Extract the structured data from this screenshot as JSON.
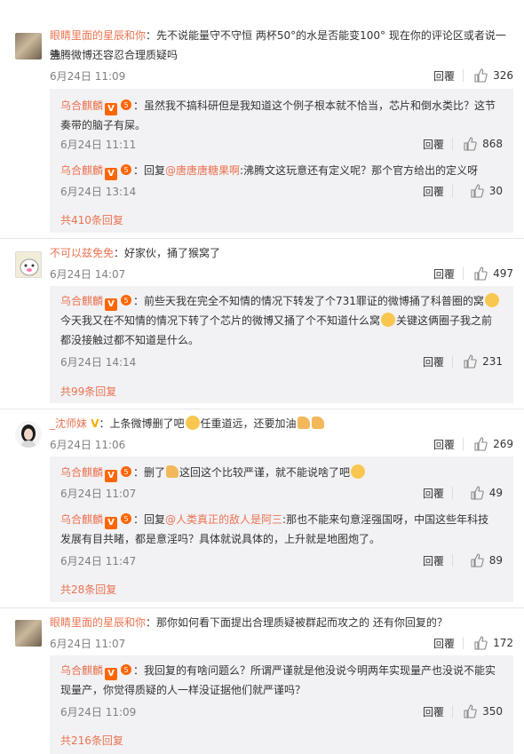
{
  "comments": [
    {
      "user": "眼睛里面的星辰和你",
      "text": "：先不说能量守不守恒 两杯50°的水是否能变100° 现在你的评论区或者说一些",
      "text2": "沸腾微博还容忍合理质疑吗",
      "time": "6月24日 11:09",
      "reply": "回覆",
      "likes": "326",
      "replies": [
        {
          "user": "乌合麒麟",
          "text": "：虽然我不搞科研但是我知道这个例子根本就不恰当，芯片和倒水类比？这节",
          "text2": "奏带的脑子有屎。",
          "time": "6月24日 11:11",
          "reply": "回覆",
          "likes": "868"
        },
        {
          "user": "乌合麒麟",
          "text_pre": "：回复",
          "mention": "@唐唐唐糖果啊",
          "text": ":沸腾文这玩意还有定义呢？那个官方给出的定义呀",
          "time": "6月24日 13:14",
          "reply": "回覆",
          "likes": "30"
        }
      ],
      "more": "共410条回复"
    },
    {
      "user": "不可以兹免免",
      "text": "：好家伙，捅了猴窝了",
      "time": "6月24日 14:07",
      "reply": "回覆",
      "likes": "497",
      "replies": [
        {
          "user": "乌合麒麟",
          "text": "：前些天我在完全不知情的情况下转发了个731罪证的微博捅了科普圈的窝",
          "text2": "今天我又在不知情的情况下转了个芯片的微博又捅了个不知道什么窝",
          "text2b": "关键这俩圈子我之前",
          "text3": "都没接触过都不知道是什么。",
          "time": "6月24日 14:14",
          "reply": "回覆",
          "likes": "231"
        }
      ],
      "more": "共99条回复"
    },
    {
      "user": "_沈师妹",
      "text_a": "：上条微博删了吧",
      "text_b": "任重道远，还要加油",
      "time": "6月24日 11:06",
      "reply": "回覆",
      "likes": "269",
      "replies": [
        {
          "user": "乌合麒麟",
          "text_a": "：删了",
          "text_b": "这回这个比较严谨，就不能说啥了吧",
          "time": "6月24日 11:07",
          "reply": "回覆",
          "likes": "49"
        },
        {
          "user": "乌合麒麟",
          "text_pre": "：回复",
          "mention": "@人类真正的敌人是阿三",
          "text": ":那也不能来句意淫强国呀，中国这些年科技",
          "text2": "发展有目共睹，都是意淫吗？具体就说具体的，上升就是地图炮了。",
          "time": "6月24日 11:47",
          "reply": "回覆",
          "likes": "89"
        }
      ],
      "more": "共28条回复"
    },
    {
      "user": "眼睛里面的星辰和你",
      "text": "：那你如何看下面提出合理质疑被群起而攻之的 还有你回复的？",
      "time": "6月24日 11:07",
      "reply": "回覆",
      "likes": "172",
      "replies": [
        {
          "user": "乌合麒麟",
          "text": "：我回复的有啥问题么？所谓严谨就是他没说今明两年实现量产也没说不能实",
          "text2": "现量产，你觉得质疑的人一样没证据他们就严谨吗？",
          "time": "6月24日 11:09",
          "reply": "回覆",
          "likes": "350"
        }
      ],
      "more": "共216条回复"
    }
  ]
}
